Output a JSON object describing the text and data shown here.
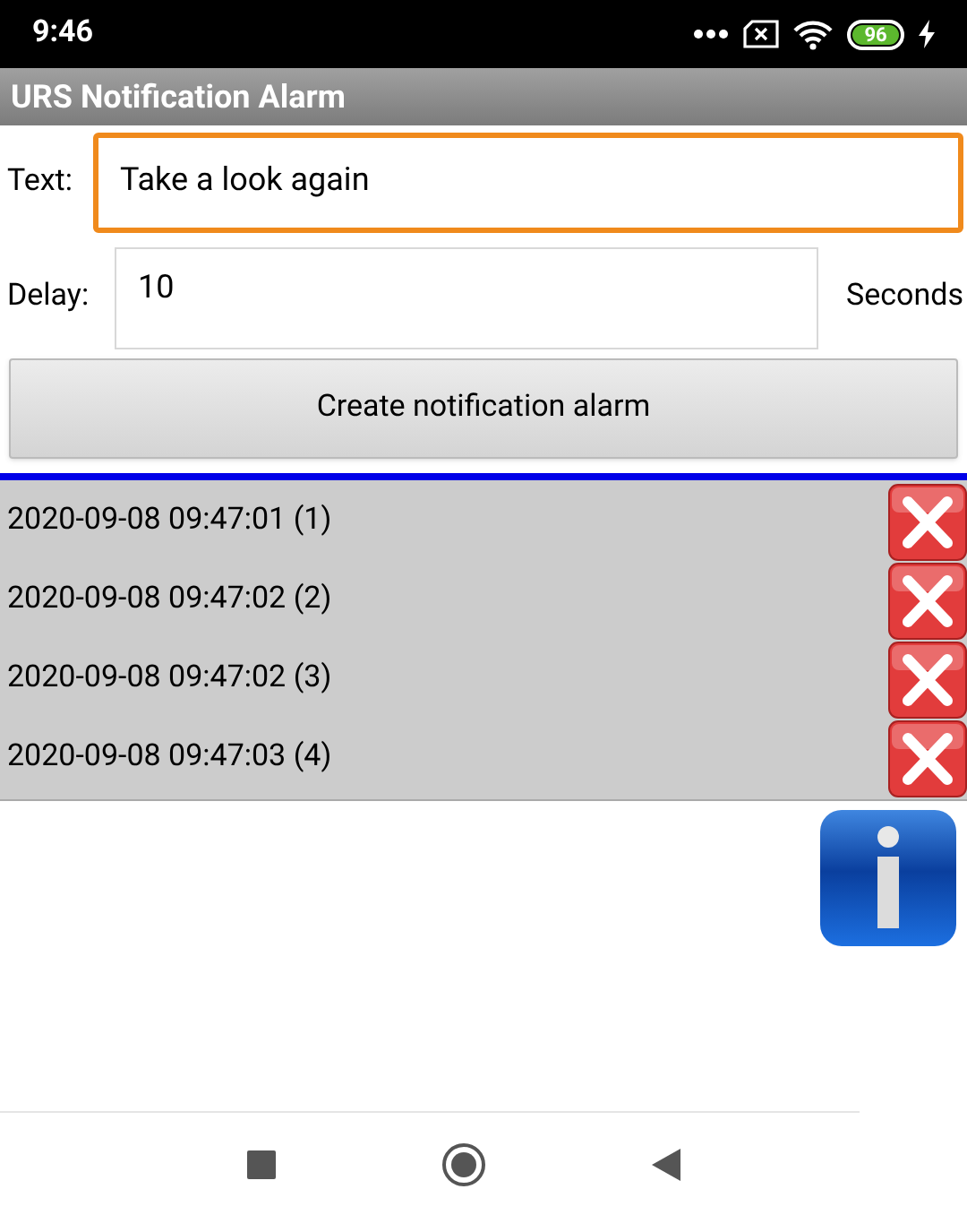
{
  "status_bar": {
    "time": "9:46",
    "battery": "96"
  },
  "title": "URS Notification Alarm",
  "text_field": {
    "label": "Text:",
    "value": "Take a look again",
    "focused": true
  },
  "delay_field": {
    "label": "Delay:",
    "value": "10",
    "unit": "Seconds",
    "focused": false
  },
  "create_button": "Create notification alarm",
  "alarms": [
    {
      "label": "2020-09-08 09:47:01 (1)"
    },
    {
      "label": "2020-09-08 09:47:02 (2)"
    },
    {
      "label": "2020-09-08 09:47:02 (3)"
    },
    {
      "label": "2020-09-08 09:47:03 (4)"
    }
  ]
}
